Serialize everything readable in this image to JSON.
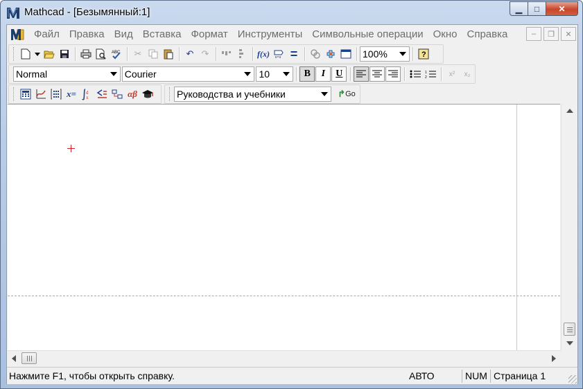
{
  "window": {
    "title": "Mathcad - [Безымянный:1]",
    "minimize_glyph": "▁",
    "maximize_glyph": "□",
    "close_glyph": "✕"
  },
  "menu": {
    "items": [
      "Файл",
      "Правка",
      "Вид",
      "Вставка",
      "Формат",
      "Инструменты",
      "Символьные операции",
      "Окно",
      "Справка"
    ],
    "doc_minimize_glyph": "–",
    "doc_restore_glyph": "❐",
    "doc_close_glyph": "✕"
  },
  "standard_toolbar": {
    "zoom_value": "100%",
    "math_function_label": "f(x)",
    "equals_label": "="
  },
  "formatting_toolbar": {
    "style": "Normal",
    "font": "Courier",
    "size": "10",
    "bold_label": "B",
    "italic_label": "I",
    "underline_label": "U",
    "superscript_label": "x²",
    "subscript_label": "x₂"
  },
  "math_toolbar": {
    "tutorials_value": "Руководства и учебники",
    "go_label": "Go",
    "assign_label": "x=",
    "greek_label": "αβ"
  },
  "status": {
    "message": "Нажмите F1, чтобы открыть справку.",
    "mode": "АВТО",
    "num": "NUM",
    "page": "Страница 1"
  },
  "colors": {
    "accent": "#2b5aa3",
    "crosshair": "#d8202a",
    "close_button": "#c7462d"
  }
}
